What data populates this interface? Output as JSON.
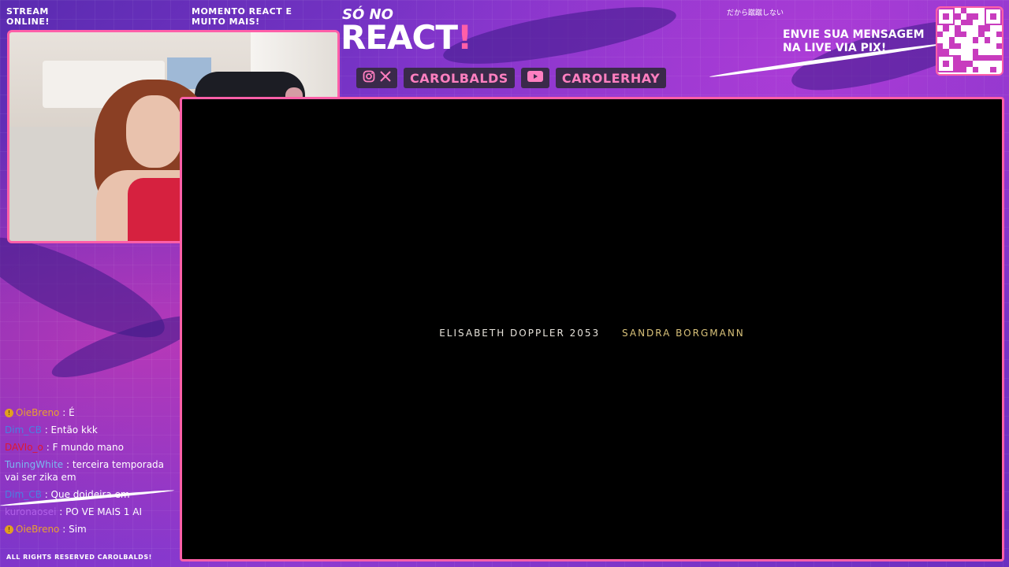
{
  "overlay": {
    "top_left_label": "STREAM ONLINE!",
    "top_mid_label": "MOMENTO REACT E MUITO MAIS!",
    "title_prefix": "SÓ NO",
    "title_main": "REACT",
    "title_bang": "!",
    "japanese_text": "だから蹴蹴しない",
    "pix_message": "ENVIE SUA MENSAGEM NA LIVE VIA PIX!",
    "footer": "ALL RIGHTS RESERVED CAROLBALDS!",
    "accent_color": "#ff5fa8"
  },
  "social": [
    {
      "icons": [
        "instagram-icon",
        "x-icon"
      ],
      "handle": "CAROLBALDS"
    },
    {
      "icons": [
        "youtube-icon"
      ],
      "handle": "CAROLERHAY"
    }
  ],
  "video": {
    "credit_role": "ELISABETH DOPPLER 2053",
    "credit_name": "SANDRA BORGMANN"
  },
  "chat": [
    {
      "badge": true,
      "user": "OieBreno",
      "color": "#e8a030",
      "text": ": É"
    },
    {
      "badge": false,
      "user": "Dim_CB",
      "color": "#4a80e0",
      "text": ": Então kkk"
    },
    {
      "badge": false,
      "user": "DAVIo_o",
      "color": "#e01830",
      "text": ": F mundo mano"
    },
    {
      "badge": false,
      "user": "TuningWhite",
      "color": "#7ab8f0",
      "text": ": terceira temporada vai ser zika em"
    },
    {
      "badge": false,
      "user": "Dim_CB",
      "color": "#4a80e0",
      "text": ": Que doideira em"
    },
    {
      "badge": false,
      "user": "kuronaosei",
      "color": "#b060e8",
      "text": ": PO VE MAIS 1 AI"
    },
    {
      "badge": true,
      "user": "OieBreno",
      "color": "#e8a030",
      "text": ": Sim"
    }
  ]
}
